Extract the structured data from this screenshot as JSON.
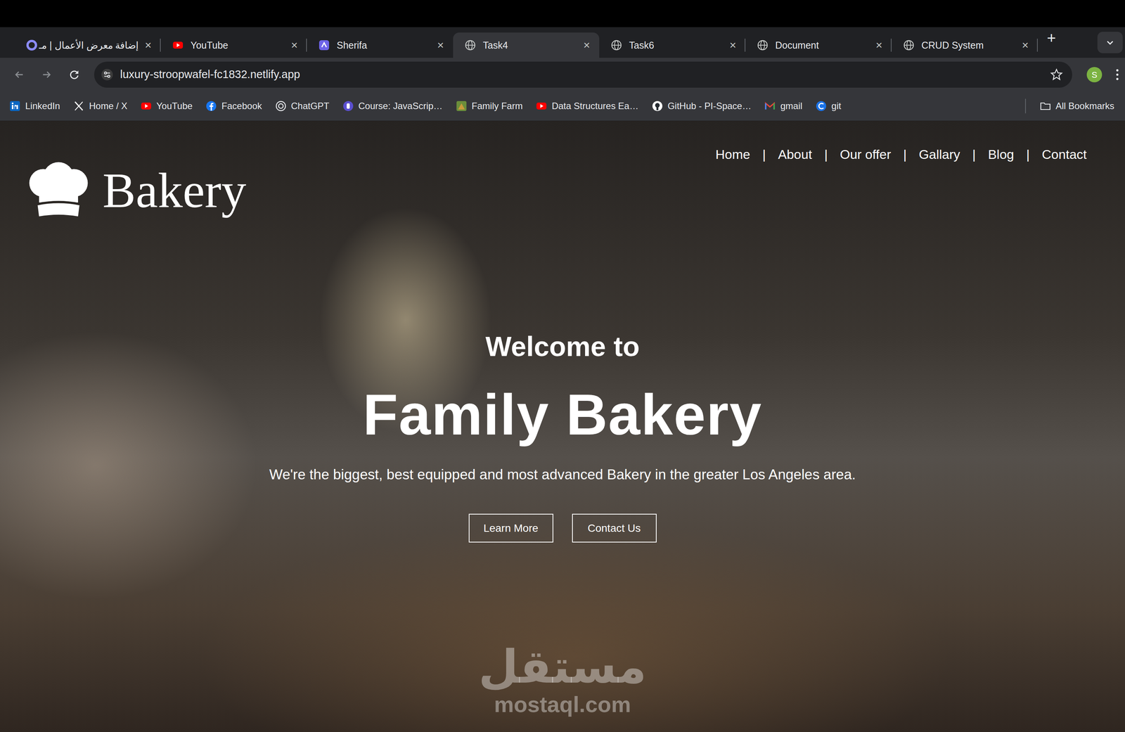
{
  "browser": {
    "tabs": [
      {
        "label": "إضافة معرض الأعمال | مـ",
        "close": "×",
        "selected": false
      },
      {
        "label": "YouTube",
        "close": "×",
        "selected": false
      },
      {
        "label": "Sherifa",
        "close": "×",
        "selected": false
      },
      {
        "label": "Task4",
        "close": "×",
        "selected": true
      },
      {
        "label": "Task6",
        "close": "×",
        "selected": false
      },
      {
        "label": "Document",
        "close": "×",
        "selected": false
      },
      {
        "label": "CRUD System",
        "close": "×",
        "selected": false
      }
    ],
    "new_tab": "+",
    "address": "luxury-stroopwafel-fc1832.netlify.app",
    "profile": "S",
    "bookmarks": [
      "LinkedIn",
      "Home / X",
      "YouTube",
      "Facebook",
      "ChatGPT",
      "Course: JavaScrip…",
      "Family Farm",
      "Data Structures Ea…",
      "GitHub - PI-Space…",
      "gmail",
      "git"
    ],
    "all_bookmarks": "All Bookmarks"
  },
  "site": {
    "logo": "Bakery",
    "nav": [
      "Home",
      "About",
      "Our offer",
      "Gallary",
      "Blog",
      "Contact"
    ],
    "separator": "|",
    "welcome": "Welcome to",
    "title": "Family Bakery",
    "tagline": "We're the biggest, best equipped and most advanced Bakery in the greater Los Angeles area.",
    "buttons": [
      "Learn More",
      "Contact Us"
    ]
  },
  "watermark": {
    "arabic": "مستقل",
    "latin": "mostaql.com"
  }
}
